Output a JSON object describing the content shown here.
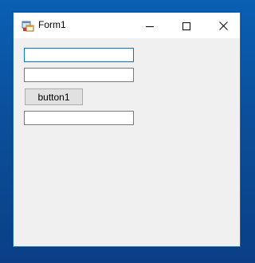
{
  "window": {
    "title": "Form1",
    "controls": {
      "minimize": "minimize",
      "maximize": "maximize",
      "close": "close"
    }
  },
  "form": {
    "textbox1": {
      "value": ""
    },
    "textbox2": {
      "value": ""
    },
    "button1_label": "button1",
    "textbox3": {
      "value": ""
    }
  },
  "colors": {
    "desktop": "#0b4f9a",
    "window_border": "#1a6fd0",
    "focus_border": "#0078d7",
    "client_bg": "#f0f0f0"
  },
  "icons": [
    "form-app-icon",
    "minimize-icon",
    "maximize-icon",
    "close-icon"
  ]
}
